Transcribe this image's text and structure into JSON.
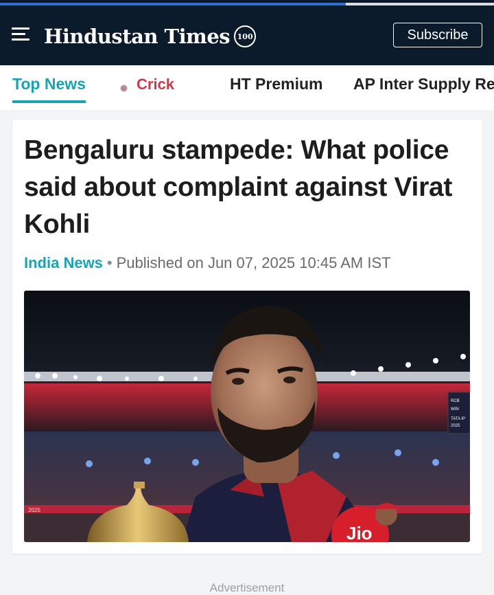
{
  "progress": {
    "fraction": 0.7,
    "fill_color": "#2f6fd0",
    "track_color": "#d9dde3"
  },
  "header": {
    "background": "#0c1b2b",
    "menu_icon": "hamburger-menu-icon",
    "logo_text": "Hindustan Times",
    "logo_badge": "100",
    "subscribe_label": "Subscribe"
  },
  "nav": {
    "accent": "#1aa3b5",
    "items": [
      {
        "label": "Top News",
        "active": true
      },
      {
        "label": "Crick",
        "live": true,
        "color": "#cf3a49"
      },
      {
        "label": "HT Premium"
      },
      {
        "label": "AP Inter Supply Re"
      }
    ]
  },
  "article": {
    "headline": "Bengaluru stampede: What police said about complaint against Virat Kohli",
    "category": "India News",
    "separator": "•",
    "published": "Published on Jun 07, 2025 10:45 AM IST",
    "hero_image": {
      "scoreboard_lines": [
        "RCB",
        "WIN",
        "TATA IP",
        "2025"
      ],
      "banner_text": "2025",
      "jersey_text": "Jio"
    }
  },
  "footer": {
    "ad_label": "Advertisement"
  }
}
